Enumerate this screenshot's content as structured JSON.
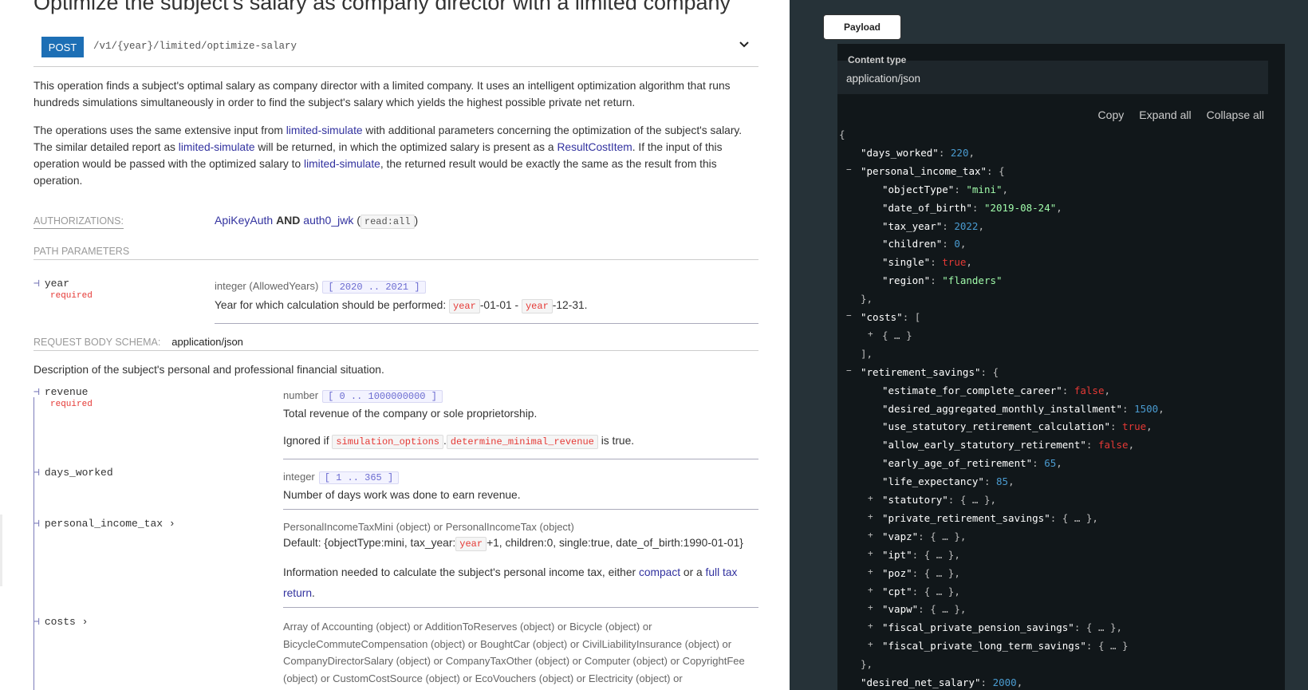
{
  "operation": {
    "title": "Optimize the subject's salary as company director with a limited company",
    "method": "POST",
    "path": "/v1/{year}/limited/optimize-salary",
    "desc1": "This operation finds a subject's optimal salary as company director with a limited company. It uses an intelligent optimization algorithm that runs hundreds simulations simultaneously in order to find the subject's salary which yields the highest possible private net return.",
    "desc2": {
      "t1": "The operations uses the same extensive input from ",
      "l1": "limited-simulate",
      "t2": " with additional parameters concerning the optimization of the subject's salary. The similar detailed report as ",
      "l2": "limited-simulate",
      "t3": " will be returned, in which the optimized salary is present as a ",
      "l3": "ResultCostItem",
      "t4": ". If the input of this operation would be passed with the optimized salary to ",
      "l4": "limited-simulate",
      "t5": ", the returned result would be exactly the same as the result from this operation."
    }
  },
  "auth": {
    "label": "AUTHORIZATIONS:",
    "a1": "ApiKeyAuth",
    "and": "AND",
    "a2": "auth0_jwk",
    "open": " (",
    "scope": "read:all",
    "close": ")"
  },
  "path_params": {
    "label": "PATH PARAMETERS",
    "year": {
      "name": "year",
      "required": "required",
      "type": "integer (AllowedYears)",
      "range": "[ 2020 .. 2021 ]",
      "d1": "Year for which calculation should be performed: ",
      "c1": "year",
      "d2": "-01-01 - ",
      "c2": "year",
      "d3": "-12-31."
    }
  },
  "body": {
    "label": "REQUEST BODY SCHEMA:",
    "content_type": "application/json",
    "description": "Description of the subject's personal and professional financial situation.",
    "revenue": {
      "name": "revenue",
      "required": "required",
      "type": "number",
      "range": "[ 0 .. 1000000000 ]",
      "desc": "Total revenue of the company or sole proprietorship.",
      "ig1": "Ignored if ",
      "c1": "simulation_options",
      "dot": ".",
      "c2": "determine_minimal_revenue",
      "ig2": " is true."
    },
    "days_worked": {
      "name": "days_worked",
      "type": "integer",
      "range": "[ 1 .. 365 ]",
      "desc": "Number of days work was done to earn revenue."
    },
    "pit": {
      "name": "personal_income_tax",
      "type": "PersonalIncomeTaxMini (object) or PersonalIncomeTax (object)",
      "d1": "Default: {objectType:mini, tax_year:",
      "c1": "year",
      "d2": "+1, children:0, single:true, date_of_birth:1990-01-01}",
      "i1": "Information needed to calculate the subject's personal income tax, either ",
      "l1": "compact",
      "i2": " or a ",
      "l2": "full tax return",
      "i3": "."
    },
    "costs": {
      "name": "costs",
      "type": "Array of Accounting (object) or AdditionToReserves (object) or Bicycle (object) or BicycleCommuteCompensation (object) or BoughtCar (object) or CivilLiabilityInsurance (object) or CompanyDirectorSalary (object) or CompanyTaxOther (object) or Computer (object) or CopyrightFee (object) or CustomCostSource (object) or EcoVouchers (object) or Electricity (object) or EmployerCommuteCompensation (object) or ExpenseAllowance (object) or HealthInsurance (object) or"
    }
  },
  "panel": {
    "tab": "Payload",
    "content_type_label": "Content type",
    "content_type": "application/json",
    "copy": "Copy",
    "expand": "Expand all",
    "collapse": "Collapse all",
    "lines": [
      {
        "l": 0,
        "p": "{"
      },
      {
        "l": 1,
        "k": "days_worked",
        "v": "220",
        "t": "n",
        "e": ","
      },
      {
        "l": 1,
        "tg": "−",
        "k": "personal_income_tax",
        "p": "{"
      },
      {
        "l": 2,
        "k": "objectType",
        "v": "\"mini\"",
        "t": "s",
        "e": ","
      },
      {
        "l": 2,
        "k": "date_of_birth",
        "v": "\"2019-08-24\"",
        "t": "s",
        "e": ","
      },
      {
        "l": 2,
        "k": "tax_year",
        "v": "2022",
        "t": "n",
        "e": ","
      },
      {
        "l": 2,
        "k": "children",
        "v": "0",
        "t": "n",
        "e": ","
      },
      {
        "l": 2,
        "k": "single",
        "v": "true",
        "t": "b",
        "e": ","
      },
      {
        "l": 2,
        "k": "region",
        "v": "\"flanders\"",
        "t": "s",
        "e": ""
      },
      {
        "l": 1,
        "p": "},"
      },
      {
        "l": 1,
        "tg": "−",
        "k": "costs",
        "p": "["
      },
      {
        "l": 2,
        "tg": "+",
        "p": "{ … }"
      },
      {
        "l": 1,
        "p": "],"
      },
      {
        "l": 1,
        "tg": "−",
        "k": "retirement_savings",
        "p": "{"
      },
      {
        "l": 2,
        "k": "estimate_for_complete_career",
        "v": "false",
        "t": "b",
        "e": ","
      },
      {
        "l": 2,
        "k": "desired_aggregated_monthly_installment",
        "v": "1500",
        "t": "n",
        "e": ","
      },
      {
        "l": 2,
        "k": "use_statutory_retirement_calculation",
        "v": "true",
        "t": "b",
        "e": ","
      },
      {
        "l": 2,
        "k": "allow_early_statutory_retirement",
        "v": "false",
        "t": "b",
        "e": ","
      },
      {
        "l": 2,
        "k": "early_age_of_retirement",
        "v": "65",
        "t": "n",
        "e": ","
      },
      {
        "l": 2,
        "k": "life_expectancy",
        "v": "85",
        "t": "n",
        "e": ","
      },
      {
        "l": 2,
        "tg": "+",
        "k": "statutory",
        "p": "{ … },"
      },
      {
        "l": 2,
        "tg": "+",
        "k": "private_retirement_savings",
        "p": "{ … },"
      },
      {
        "l": 2,
        "tg": "+",
        "k": "vapz",
        "p": "{ … },"
      },
      {
        "l": 2,
        "tg": "+",
        "k": "ipt",
        "p": "{ … },"
      },
      {
        "l": 2,
        "tg": "+",
        "k": "poz",
        "p": "{ … },"
      },
      {
        "l": 2,
        "tg": "+",
        "k": "cpt",
        "p": "{ … },"
      },
      {
        "l": 2,
        "tg": "+",
        "k": "vapw",
        "p": "{ … },"
      },
      {
        "l": 2,
        "tg": "+",
        "k": "fiscal_private_pension_savings",
        "p": "{ … },"
      },
      {
        "l": 2,
        "tg": "+",
        "k": "fiscal_private_long_term_savings",
        "p": "{ … }"
      },
      {
        "l": 1,
        "p": "},"
      },
      {
        "l": 1,
        "k": "desired_net_salary",
        "v": "2000",
        "t": "n",
        "e": ","
      }
    ]
  },
  "colors": {
    "accent": "#32329f",
    "post": "#1d6fb5",
    "panel": "#263238",
    "code": "#11171a",
    "string": "#a0fbaa",
    "number": "#4a9bd0",
    "boolean": "#e53935"
  }
}
